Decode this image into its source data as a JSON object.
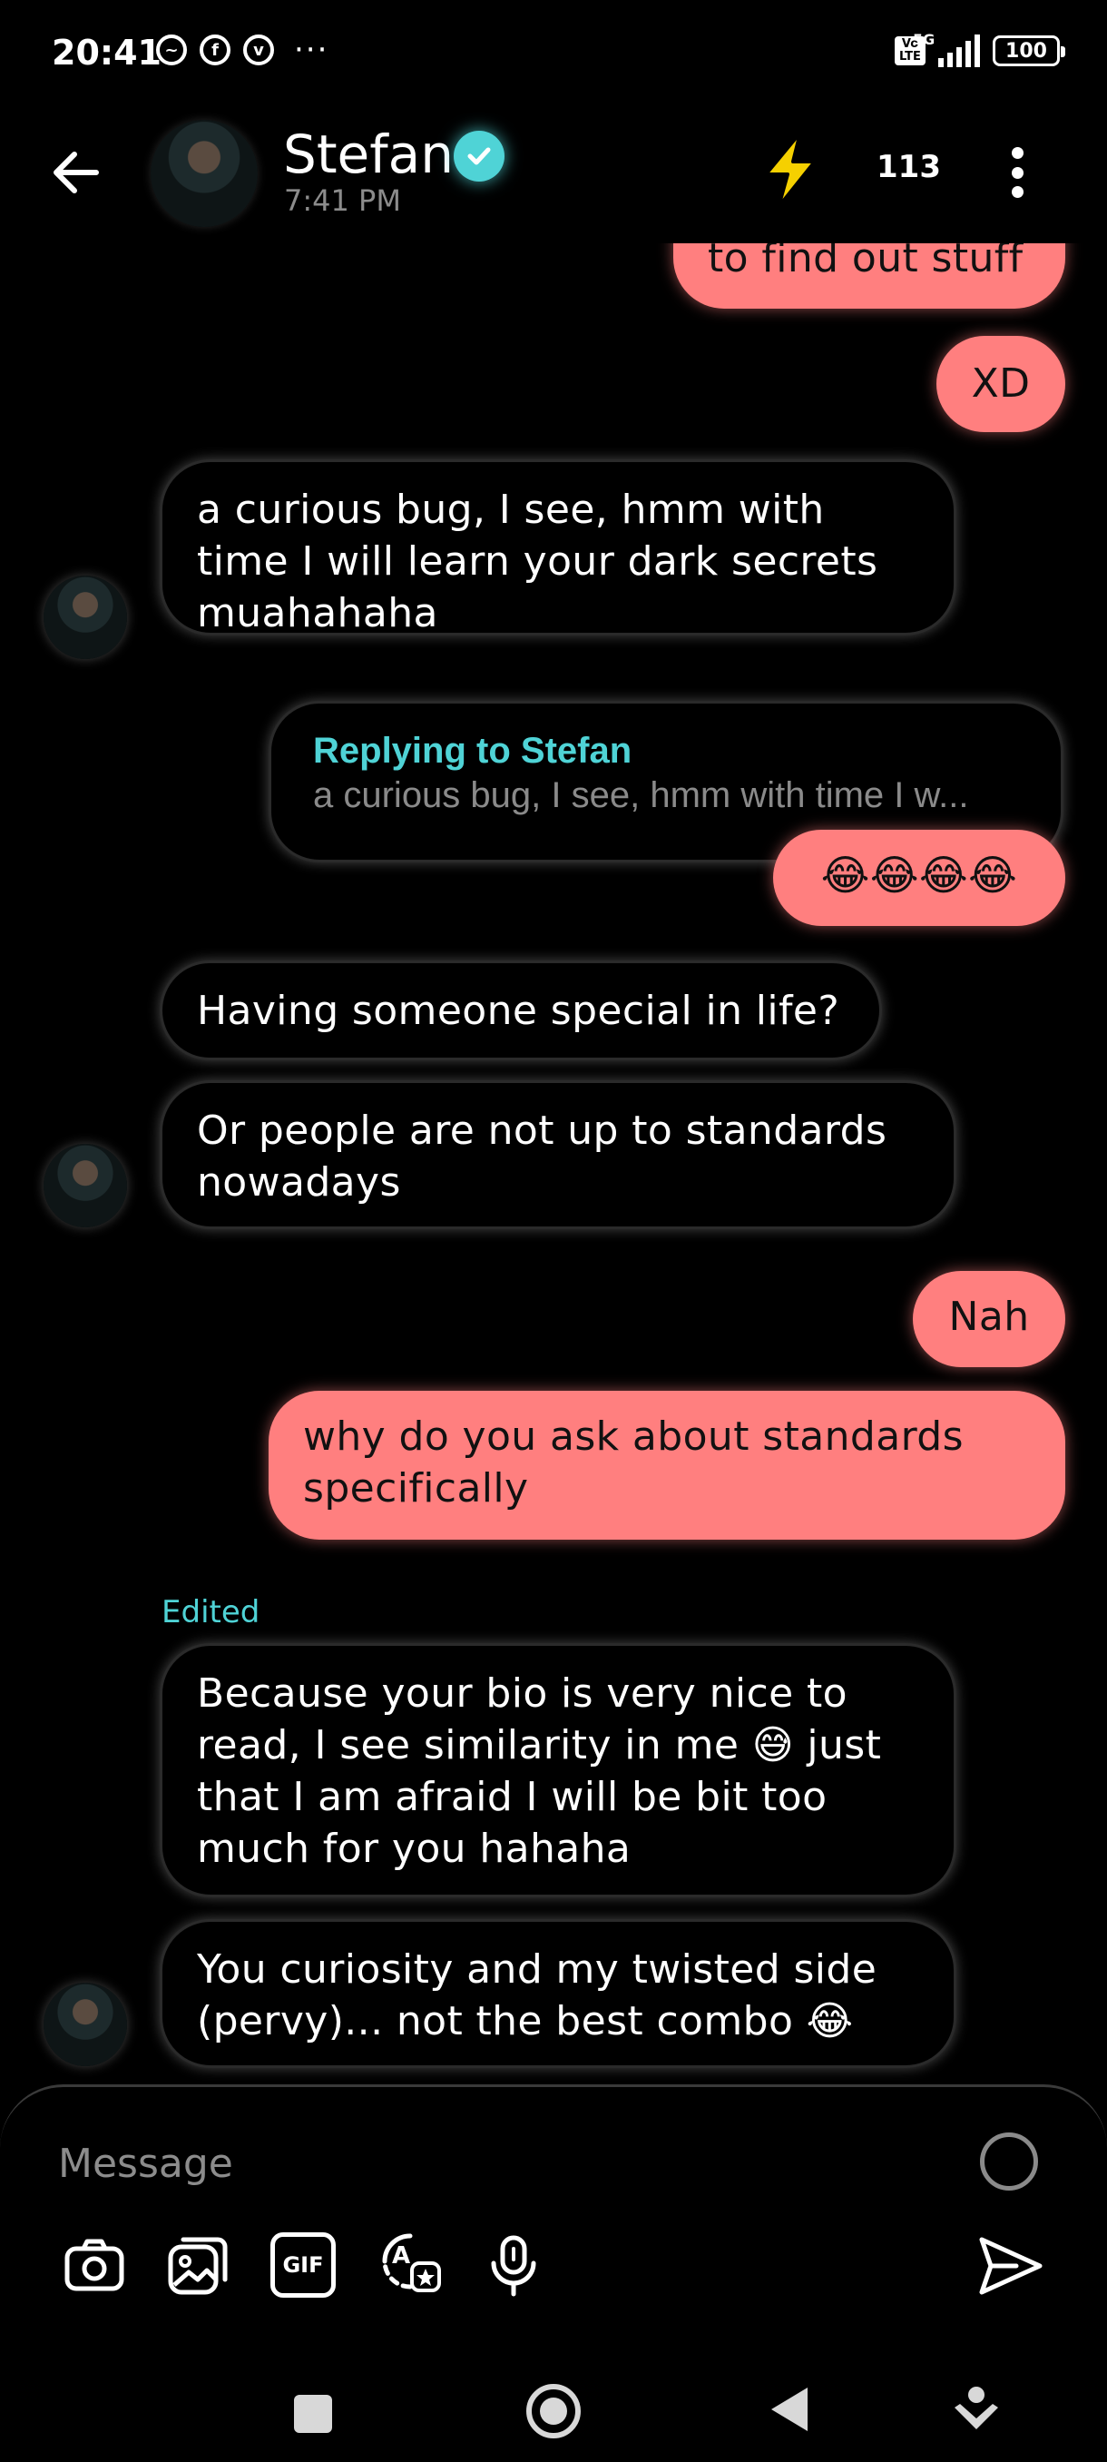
{
  "status_bar": {
    "time": "20:41",
    "network": "5G",
    "volte": "Vo LTE",
    "battery": "100",
    "dots": "···"
  },
  "header": {
    "name": "Stefan",
    "subtitle": "7:41 PM",
    "count": "113"
  },
  "messages": [
    {
      "side": "out",
      "text": "to find out stuff"
    },
    {
      "side": "out",
      "text": "XD"
    },
    {
      "side": "in",
      "text": "a curious bug, I see, hmm with time I will learn your dark secrets muahahaha"
    },
    {
      "side": "out",
      "text": "😂😂😂😂"
    },
    {
      "side": "in",
      "text": "Having someone special in life?"
    },
    {
      "side": "in",
      "text": "Or people are not up to standards nowadays"
    },
    {
      "side": "out",
      "text": "Nah"
    },
    {
      "side": "out",
      "text": "why do you ask about standards specifically"
    },
    {
      "side": "in",
      "text": "Because your bio is very nice to read, I see similarity in me 😅 just that I am afraid I will be bit too much for you hahaha"
    },
    {
      "side": "in",
      "text": "You curiosity and my twisted side (pervy)... not the best combo 😂"
    }
  ],
  "reply": {
    "title": "Replying to Stefan",
    "snippet": "a curious bug, I see, hmm with time I w..."
  },
  "edited_label": "Edited",
  "composer": {
    "placeholder": "Message",
    "gif_label": "GIF"
  },
  "icons": [
    "back-arrow-icon",
    "verified-icon",
    "lightning-bolt-icon",
    "more-options-icon",
    "camera-icon",
    "gallery-icon",
    "gif-icon",
    "sticker-icon",
    "microphone-icon",
    "send-icon"
  ],
  "colors": {
    "outgoing_bubble": "#ff7f7f",
    "accent": "#4fd3d6",
    "bolt": "#f5d000"
  }
}
